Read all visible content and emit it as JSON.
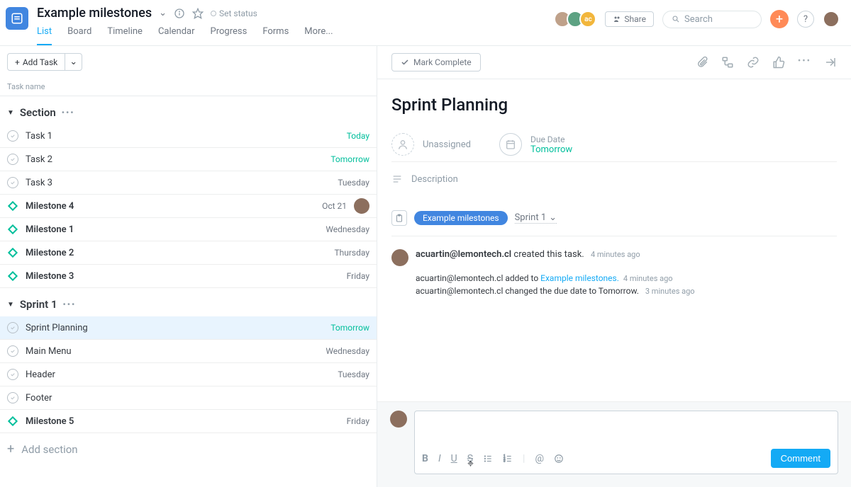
{
  "header": {
    "title": "Example milestones",
    "set_status": "Set status",
    "tabs": [
      "List",
      "Board",
      "Timeline",
      "Calendar",
      "Progress",
      "Forms",
      "More..."
    ],
    "active_tab": "List",
    "share": "Share",
    "search_placeholder": "Search"
  },
  "toolbar": {
    "add_task": "Add Task",
    "col_header": "Task name"
  },
  "sections": [
    {
      "name": "Section",
      "tasks": [
        {
          "type": "task",
          "name": "Task 1",
          "date": "Today",
          "date_color": "green"
        },
        {
          "type": "task",
          "name": "Task 2",
          "date": "Tomorrow",
          "date_color": "green"
        },
        {
          "type": "task",
          "name": "Task 3",
          "date": "Tuesday",
          "date_color": ""
        },
        {
          "type": "milestone",
          "name": "Milestone 4",
          "date": "Oct 21",
          "date_color": "",
          "avatar": true
        },
        {
          "type": "milestone",
          "name": "Milestone 1",
          "date": "Wednesday",
          "date_color": ""
        },
        {
          "type": "milestone",
          "name": "Milestone 2",
          "date": "Thursday",
          "date_color": ""
        },
        {
          "type": "milestone",
          "name": "Milestone 3",
          "date": "Friday",
          "date_color": ""
        }
      ]
    },
    {
      "name": "Sprint 1",
      "tasks": [
        {
          "type": "task",
          "name": "Sprint Planning",
          "date": "Tomorrow",
          "date_color": "green",
          "selected": true
        },
        {
          "type": "task",
          "name": "Main Menu",
          "date": "Wednesday",
          "date_color": ""
        },
        {
          "type": "task",
          "name": "Header",
          "date": "Tuesday",
          "date_color": ""
        },
        {
          "type": "task",
          "name": "Footer",
          "date": "",
          "date_color": ""
        },
        {
          "type": "milestone",
          "name": "Milestone 5",
          "date": "Friday",
          "date_color": ""
        }
      ]
    }
  ],
  "add_section": "Add section",
  "detail": {
    "mark_complete": "Mark Complete",
    "title": "Sprint Planning",
    "unassigned": "Unassigned",
    "due_label": "Due Date",
    "due_value": "Tomorrow",
    "description": "Description",
    "project_pill": "Example milestones",
    "project_section": "Sprint 1",
    "activity": {
      "creator": "acuartin@lemontech.cl",
      "created_text": "created this task.",
      "created_time": "4 minutes ago",
      "logs": [
        {
          "user": "acuartin@lemontech.cl",
          "text": "added to",
          "link": "Example milestones.",
          "time": "4 minutes ago"
        },
        {
          "user": "acuartin@lemontech.cl",
          "text": "changed the due date to Tomorrow.",
          "link": "",
          "time": "3 minutes ago"
        }
      ]
    },
    "comment_btn": "Comment"
  }
}
